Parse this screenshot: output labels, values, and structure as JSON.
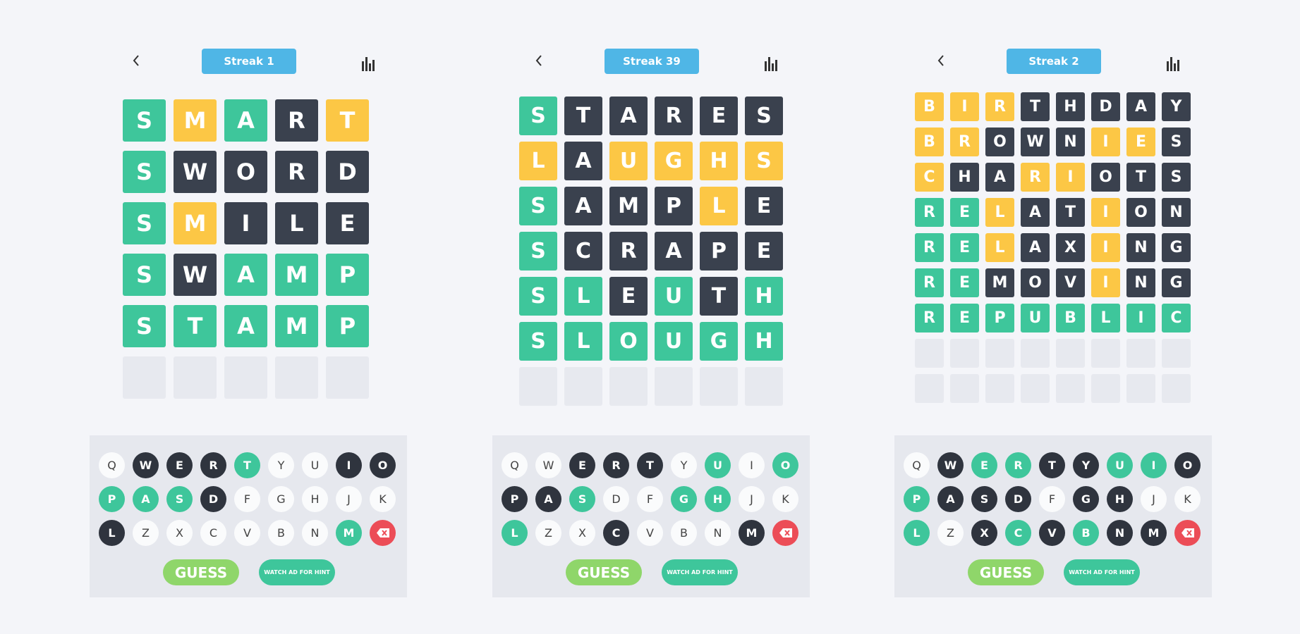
{
  "icons": {
    "back": "chevron-left-icon",
    "stats": "bar-chart-icon",
    "delete": "backspace-icon"
  },
  "colors": {
    "green": "#3ec69b",
    "yellow": "#fcc745",
    "dark": "#3a414e",
    "empty": "#e7e9ef",
    "streak": "#4fb6e6",
    "guess": "#8fd66a",
    "delete": "#ec4d57"
  },
  "panels": [
    {
      "streak": "Streak 1",
      "rows": [
        {
          "letters": [
            "S",
            "M",
            "A",
            "R",
            "T"
          ],
          "states": [
            "g",
            "y",
            "g",
            "d",
            "y"
          ]
        },
        {
          "letters": [
            "S",
            "W",
            "O",
            "R",
            "D"
          ],
          "states": [
            "g",
            "d",
            "d",
            "d",
            "d"
          ]
        },
        {
          "letters": [
            "S",
            "M",
            "I",
            "L",
            "E"
          ],
          "states": [
            "g",
            "y",
            "d",
            "d",
            "d"
          ]
        },
        {
          "letters": [
            "S",
            "W",
            "A",
            "M",
            "P"
          ],
          "states": [
            "g",
            "d",
            "g",
            "g",
            "g"
          ]
        },
        {
          "letters": [
            "S",
            "T",
            "A",
            "M",
            "P"
          ],
          "states": [
            "g",
            "g",
            "g",
            "g",
            "g"
          ]
        },
        {
          "letters": [
            "",
            "",
            "",
            "",
            ""
          ],
          "states": [
            "e",
            "e",
            "e",
            "e",
            "e"
          ]
        }
      ],
      "keyboard": [
        [
          [
            "Q",
            "w"
          ],
          [
            "W",
            "d"
          ],
          [
            "E",
            "d"
          ],
          [
            "R",
            "d"
          ],
          [
            "T",
            "g"
          ],
          [
            "Y",
            "w"
          ],
          [
            "U",
            "w"
          ],
          [
            "I",
            "d"
          ],
          [
            "O",
            "d"
          ]
        ],
        [
          [
            "P",
            "g"
          ],
          [
            "A",
            "g"
          ],
          [
            "S",
            "g"
          ],
          [
            "D",
            "d"
          ],
          [
            "F",
            "w"
          ],
          [
            "G",
            "w"
          ],
          [
            "H",
            "w"
          ],
          [
            "J",
            "w"
          ],
          [
            "K",
            "w"
          ]
        ],
        [
          [
            "L",
            "d"
          ],
          [
            "Z",
            "w"
          ],
          [
            "X",
            "w"
          ],
          [
            "C",
            "w"
          ],
          [
            "V",
            "w"
          ],
          [
            "B",
            "w"
          ],
          [
            "N",
            "w"
          ],
          [
            "M",
            "g"
          ],
          [
            "",
            "r"
          ]
        ]
      ],
      "guess_label": "GUESS",
      "hint_label": "WATCH AD FOR HINT"
    },
    {
      "streak": "Streak 39",
      "rows": [
        {
          "letters": [
            "S",
            "T",
            "A",
            "R",
            "E",
            "S"
          ],
          "states": [
            "g",
            "d",
            "d",
            "d",
            "d",
            "d"
          ]
        },
        {
          "letters": [
            "L",
            "A",
            "U",
            "G",
            "H",
            "S"
          ],
          "states": [
            "y",
            "d",
            "y",
            "y",
            "y",
            "y"
          ]
        },
        {
          "letters": [
            "S",
            "A",
            "M",
            "P",
            "L",
            "E"
          ],
          "states": [
            "g",
            "d",
            "d",
            "d",
            "y",
            "d"
          ]
        },
        {
          "letters": [
            "S",
            "C",
            "R",
            "A",
            "P",
            "E"
          ],
          "states": [
            "g",
            "d",
            "d",
            "d",
            "d",
            "d"
          ]
        },
        {
          "letters": [
            "S",
            "L",
            "E",
            "U",
            "T",
            "H"
          ],
          "states": [
            "g",
            "g",
            "d",
            "g",
            "d",
            "g"
          ]
        },
        {
          "letters": [
            "S",
            "L",
            "O",
            "U",
            "G",
            "H"
          ],
          "states": [
            "g",
            "g",
            "g",
            "g",
            "g",
            "g"
          ]
        },
        {
          "letters": [
            "",
            "",
            "",
            "",
            "",
            ""
          ],
          "states": [
            "e",
            "e",
            "e",
            "e",
            "e",
            "e"
          ]
        }
      ],
      "keyboard": [
        [
          [
            "Q",
            "w"
          ],
          [
            "W",
            "w"
          ],
          [
            "E",
            "d"
          ],
          [
            "R",
            "d"
          ],
          [
            "T",
            "d"
          ],
          [
            "Y",
            "w"
          ],
          [
            "U",
            "g"
          ],
          [
            "I",
            "w"
          ],
          [
            "O",
            "g"
          ]
        ],
        [
          [
            "P",
            "d"
          ],
          [
            "A",
            "d"
          ],
          [
            "S",
            "g"
          ],
          [
            "D",
            "w"
          ],
          [
            "F",
            "w"
          ],
          [
            "G",
            "g"
          ],
          [
            "H",
            "g"
          ],
          [
            "J",
            "w"
          ],
          [
            "K",
            "w"
          ]
        ],
        [
          [
            "L",
            "g"
          ],
          [
            "Z",
            "w"
          ],
          [
            "X",
            "w"
          ],
          [
            "C",
            "d"
          ],
          [
            "V",
            "w"
          ],
          [
            "B",
            "w"
          ],
          [
            "N",
            "w"
          ],
          [
            "M",
            "d"
          ],
          [
            "",
            "r"
          ]
        ]
      ],
      "guess_label": "GUESS",
      "hint_label": "WATCH AD FOR HINT"
    },
    {
      "streak": "Streak 2",
      "rows": [
        {
          "letters": [
            "B",
            "I",
            "R",
            "T",
            "H",
            "D",
            "A",
            "Y"
          ],
          "states": [
            "y",
            "y",
            "y",
            "d",
            "d",
            "d",
            "d",
            "d"
          ]
        },
        {
          "letters": [
            "B",
            "R",
            "O",
            "W",
            "N",
            "I",
            "E",
            "S"
          ],
          "states": [
            "y",
            "y",
            "d",
            "d",
            "d",
            "y",
            "y",
            "d"
          ]
        },
        {
          "letters": [
            "C",
            "H",
            "A",
            "R",
            "I",
            "O",
            "T",
            "S"
          ],
          "states": [
            "y",
            "d",
            "d",
            "y",
            "y",
            "d",
            "d",
            "d"
          ]
        },
        {
          "letters": [
            "R",
            "E",
            "L",
            "A",
            "T",
            "I",
            "O",
            "N"
          ],
          "states": [
            "g",
            "g",
            "y",
            "d",
            "d",
            "y",
            "d",
            "d"
          ]
        },
        {
          "letters": [
            "R",
            "E",
            "L",
            "A",
            "X",
            "I",
            "N",
            "G"
          ],
          "states": [
            "g",
            "g",
            "y",
            "d",
            "d",
            "y",
            "d",
            "d"
          ]
        },
        {
          "letters": [
            "R",
            "E",
            "M",
            "O",
            "V",
            "I",
            "N",
            "G"
          ],
          "states": [
            "g",
            "g",
            "d",
            "d",
            "d",
            "y",
            "d",
            "d"
          ]
        },
        {
          "letters": [
            "R",
            "E",
            "P",
            "U",
            "B",
            "L",
            "I",
            "C"
          ],
          "states": [
            "g",
            "g",
            "g",
            "g",
            "g",
            "g",
            "g",
            "g"
          ]
        },
        {
          "letters": [
            "",
            "",
            "",
            "",
            "",
            "",
            "",
            ""
          ],
          "states": [
            "e",
            "e",
            "e",
            "e",
            "e",
            "e",
            "e",
            "e"
          ]
        },
        {
          "letters": [
            "",
            "",
            "",
            "",
            "",
            "",
            "",
            ""
          ],
          "states": [
            "e",
            "e",
            "e",
            "e",
            "e",
            "e",
            "e",
            "e"
          ]
        }
      ],
      "keyboard": [
        [
          [
            "Q",
            "w"
          ],
          [
            "W",
            "d"
          ],
          [
            "E",
            "g"
          ],
          [
            "R",
            "g"
          ],
          [
            "T",
            "d"
          ],
          [
            "Y",
            "d"
          ],
          [
            "U",
            "g"
          ],
          [
            "I",
            "g"
          ],
          [
            "O",
            "d"
          ]
        ],
        [
          [
            "P",
            "g"
          ],
          [
            "A",
            "d"
          ],
          [
            "S",
            "d"
          ],
          [
            "D",
            "d"
          ],
          [
            "F",
            "w"
          ],
          [
            "G",
            "d"
          ],
          [
            "H",
            "d"
          ],
          [
            "J",
            "w"
          ],
          [
            "K",
            "w"
          ]
        ],
        [
          [
            "L",
            "g"
          ],
          [
            "Z",
            "w"
          ],
          [
            "X",
            "d"
          ],
          [
            "C",
            "g"
          ],
          [
            "V",
            "d"
          ],
          [
            "B",
            "g"
          ],
          [
            "N",
            "d"
          ],
          [
            "M",
            "d"
          ],
          [
            "",
            "r"
          ]
        ]
      ],
      "guess_label": "GUESS",
      "hint_label": "WATCH AD FOR HINT"
    }
  ]
}
